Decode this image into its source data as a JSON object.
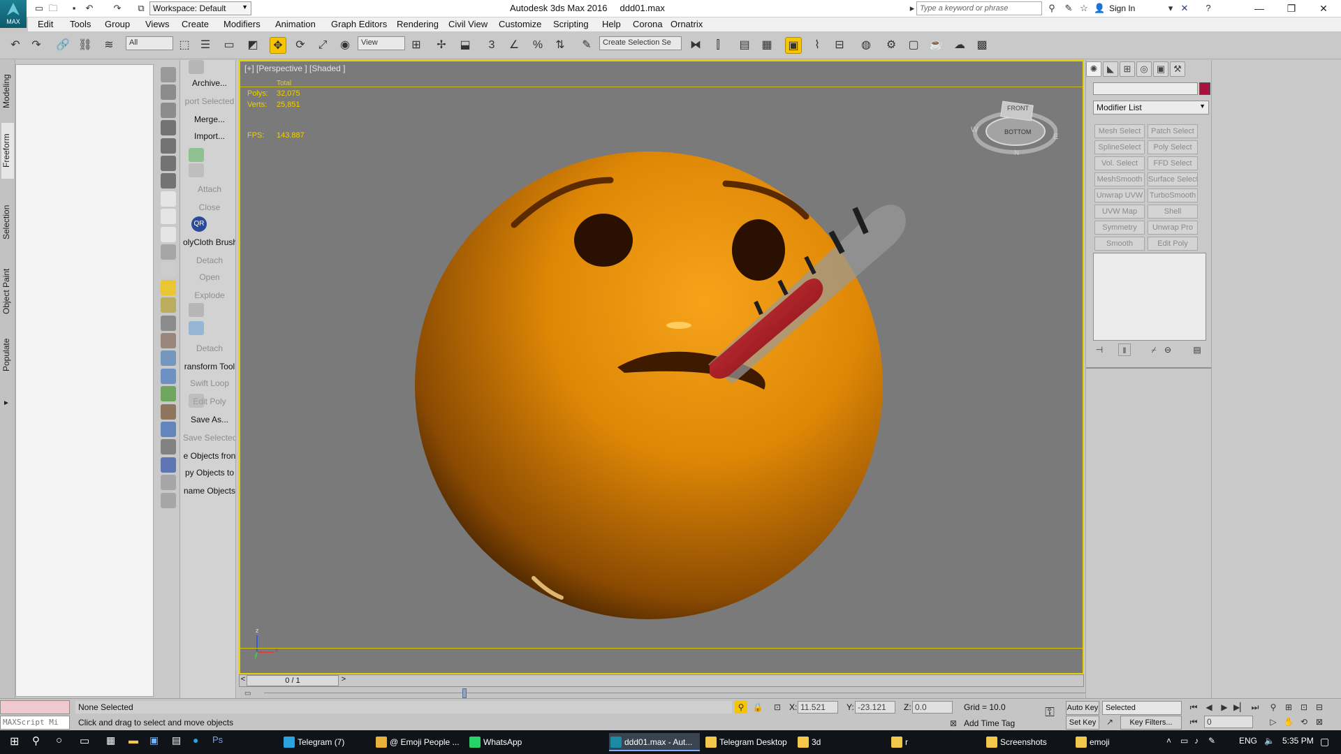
{
  "titlebar": {
    "logo_text": "MAX",
    "workspace": "Workspace: Default",
    "app_name": "Autodesk 3ds Max 2016",
    "file_name": "ddd01.max",
    "search_placeholder": "Type a keyword or phrase",
    "sign_in": "Sign In"
  },
  "menu": [
    "Edit",
    "Tools",
    "Group",
    "Views",
    "Create",
    "Modifiers",
    "Animation",
    "Graph Editors",
    "Rendering",
    "Civil View",
    "Customize",
    "Scripting",
    "Help",
    "Corona",
    "Ornatrix"
  ],
  "toolbar": {
    "filter_value": "All",
    "ref_coord_value": "View",
    "snap_3": "3",
    "named_selection_placeholder": "Create Selection Se"
  },
  "left_tabs": [
    "Modeling",
    "Freeform",
    "Selection",
    "Object Paint",
    "Populate"
  ],
  "commands": [
    {
      "label": "Archive...",
      "enabled": true
    },
    {
      "label": "port Selected",
      "enabled": false
    },
    {
      "label": "Merge...",
      "enabled": true
    },
    {
      "label": "Import...",
      "enabled": true
    },
    {
      "label": "Attach",
      "enabled": false
    },
    {
      "label": "Close",
      "enabled": false
    },
    {
      "label": "QR",
      "enabled": true
    },
    {
      "label": "olyCloth Brush",
      "enabled": true
    },
    {
      "label": "Detach",
      "enabled": false
    },
    {
      "label": "Open",
      "enabled": false
    },
    {
      "label": "Explode",
      "enabled": false
    },
    {
      "label": "Detach",
      "enabled": false
    },
    {
      "label": "ransform Tool",
      "enabled": true
    },
    {
      "label": "Swift Loop",
      "enabled": false
    },
    {
      "label": "Edit Poly",
      "enabled": false
    },
    {
      "label": "Save As...",
      "enabled": true
    },
    {
      "label": "Save Selected",
      "enabled": false
    },
    {
      "label": "e Objects fron",
      "enabled": true
    },
    {
      "label": "py Objects to",
      "enabled": true
    },
    {
      "label": "name Objects",
      "enabled": true
    }
  ],
  "viewport": {
    "label": "[+] [Perspective ] [Shaded ]",
    "stats_header": "Total",
    "polys_label": "Polys:",
    "polys_value": "32,075",
    "verts_label": "Verts:",
    "verts_value": "25,851",
    "fps_label": "FPS:",
    "fps_value": "143.887",
    "viewcube_top": "FRONT",
    "viewcube_bottom": "BOTTOM",
    "viewcube_w": "W",
    "viewcube_e": "E",
    "viewcube_n": "N",
    "axis_z": "z",
    "axis_x": "x",
    "axis_y": "y"
  },
  "timeslider": {
    "frame": "0 / 1",
    "prev": "<",
    "next": ">"
  },
  "command_panel": {
    "modifier_list": "Modifier List",
    "modifiers": [
      "Mesh Select",
      "Patch Select",
      "SplineSelect",
      "Poly Select",
      "Vol. Select",
      "FFD Select",
      "MeshSmooth",
      "Surface Select",
      "Unwrap UVW",
      "TurboSmooth",
      "UVW Map",
      "Shell",
      "Symmetry",
      "Unwrap Pro",
      "Smooth",
      "Edit Poly"
    ]
  },
  "status": {
    "maxscript": "MAXScript Mi",
    "selection": "None Selected",
    "prompt": "Click and drag to select and move objects",
    "x_label": "X:",
    "x_value": "11.521",
    "y_label": "Y:",
    "y_value": "-23.121",
    "z_label": "Z:",
    "z_value": "0.0",
    "grid": "Grid = 10.0",
    "add_time_tag": "Add Time Tag",
    "auto_key": "Auto Key",
    "set_key": "Set Key",
    "key_mode": "Selected",
    "key_filters": "Key Filters...",
    "current_frame": "0"
  },
  "taskbar": {
    "apps": [
      {
        "label": "Telegram (7)",
        "color": "#2aa3e0",
        "active": false
      },
      {
        "label": "@ Emoji People ...",
        "color": "#e8b23a",
        "active": false
      },
      {
        "label": "WhatsApp",
        "color": "#25d366",
        "active": false
      },
      {
        "label": "ddd01.max - Aut...",
        "color": "#1b8ba5",
        "active": true
      },
      {
        "label": "Telegram Desktop",
        "color": "#f3c74a",
        "active": false
      },
      {
        "label": "3d",
        "color": "#f3c74a",
        "active": false
      },
      {
        "label": "r",
        "color": "#f3c74a",
        "active": false
      },
      {
        "label": "Screenshots",
        "color": "#f3c74a",
        "active": false
      },
      {
        "label": "emoji",
        "color": "#f3c74a",
        "active": false
      }
    ],
    "language": "ENG",
    "time": "5:35 PM"
  },
  "colors": {
    "emoji_orange": "#e08a06",
    "viewport_bg": "#7a7a7a",
    "active_yellow": "#f6c400",
    "thermometer_red": "#b3131d"
  }
}
